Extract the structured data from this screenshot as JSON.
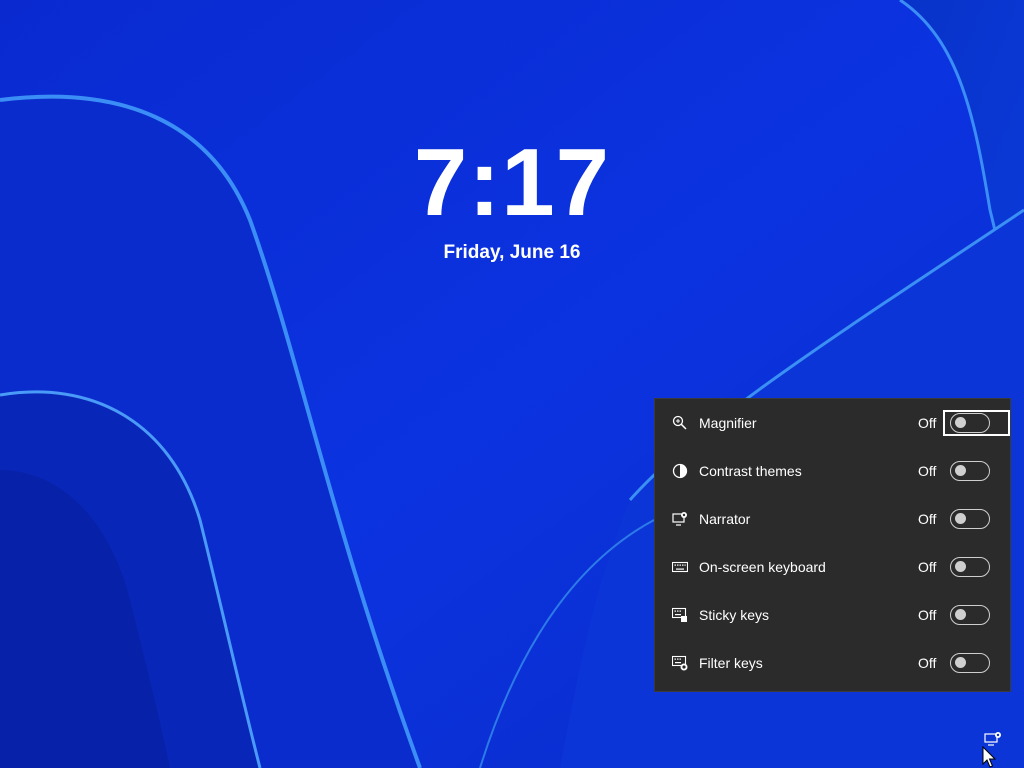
{
  "lockscreen": {
    "time": "7:17",
    "date": "Friday, June 16"
  },
  "accessibility_flyout": {
    "items": [
      {
        "label": "Magnifier",
        "state": "Off",
        "icon": "magnifier-icon"
      },
      {
        "label": "Contrast themes",
        "state": "Off",
        "icon": "contrast-icon"
      },
      {
        "label": "Narrator",
        "state": "Off",
        "icon": "narrator-icon"
      },
      {
        "label": "On-screen keyboard",
        "state": "Off",
        "icon": "keyboard-icon"
      },
      {
        "label": "Sticky keys",
        "state": "Off",
        "icon": "sticky-keys-icon"
      },
      {
        "label": "Filter keys",
        "state": "Off",
        "icon": "filter-keys-icon"
      }
    ]
  },
  "colors": {
    "wallpaper_base": "#0b2fd6",
    "flyout_background": "#2b2b2b"
  }
}
